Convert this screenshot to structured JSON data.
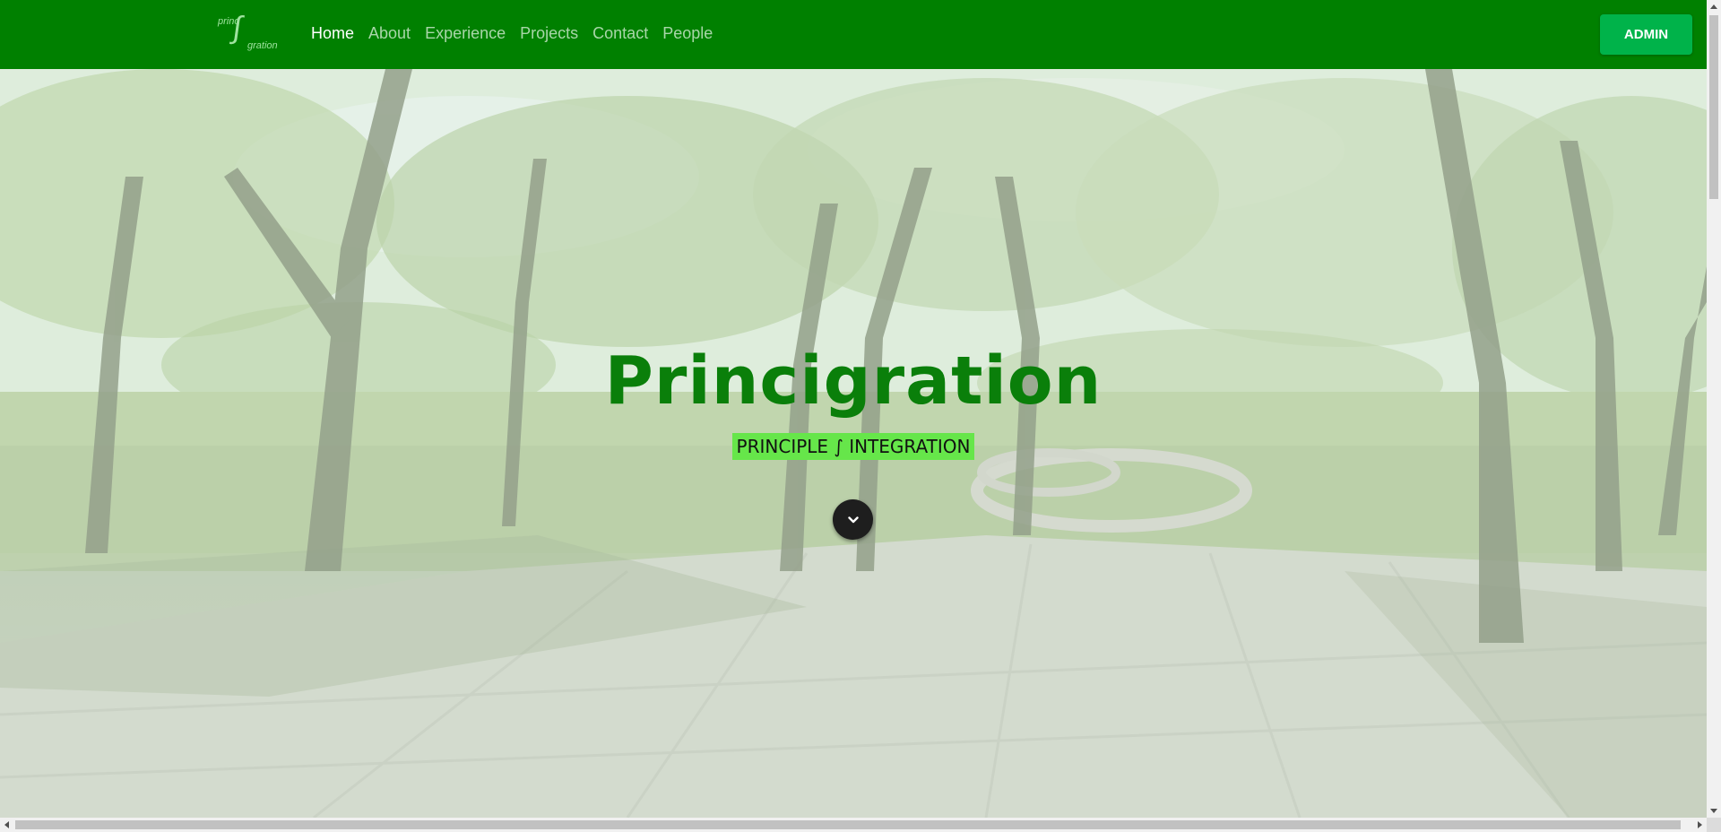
{
  "nav": {
    "logo": {
      "top_text": "princ",
      "symbol": "∫",
      "bottom_text": "gration"
    },
    "links": [
      {
        "label": "Home",
        "active": true
      },
      {
        "label": "About",
        "active": false
      },
      {
        "label": "Experience",
        "active": false
      },
      {
        "label": "Projects",
        "active": false
      },
      {
        "label": "Contact",
        "active": false
      },
      {
        "label": "People",
        "active": false
      }
    ],
    "admin_label": "ADMIN"
  },
  "hero": {
    "title": "Princigration",
    "subtitle": "PRINCIPLE ∫ INTEGRATION",
    "scroll_icon": "chevron-down-icon"
  },
  "colors": {
    "navbar": "#008000",
    "admin_button": "#00b34a",
    "title": "#0a7f0a",
    "subtitle_bg": "#66e64a",
    "scroll_button": "#1e1e1e"
  },
  "scrollbars": {
    "vertical": {
      "position": 0
    },
    "horizontal": {
      "position": 0
    }
  }
}
